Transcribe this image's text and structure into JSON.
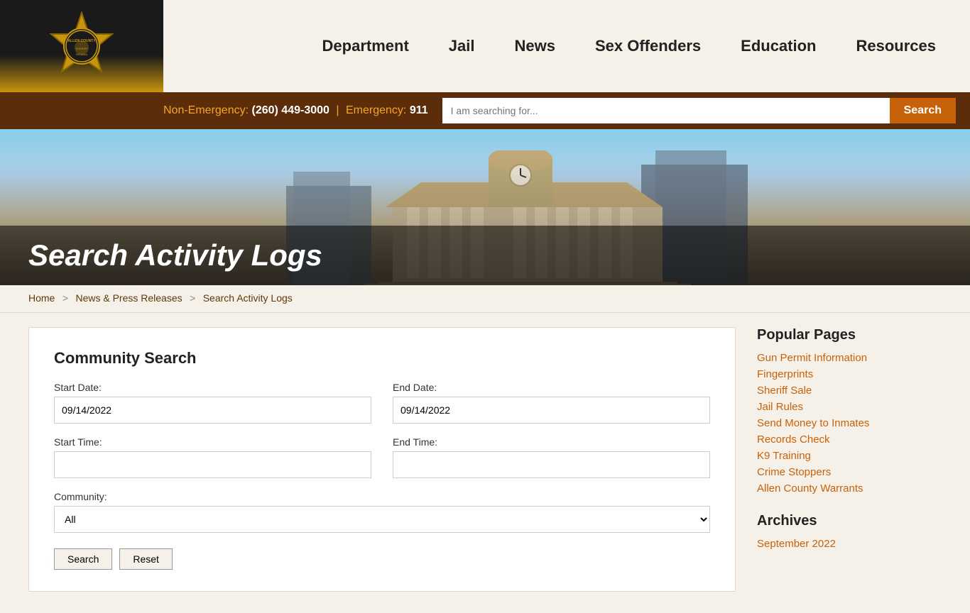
{
  "header": {
    "logo_alt": "Allen County Sheriff Indiana",
    "nav_items": [
      {
        "label": "Department",
        "id": "nav-department"
      },
      {
        "label": "Jail",
        "id": "nav-jail"
      },
      {
        "label": "News",
        "id": "nav-news"
      },
      {
        "label": "Sex Offenders",
        "id": "nav-sex-offenders"
      },
      {
        "label": "Education",
        "id": "nav-education"
      },
      {
        "label": "Resources",
        "id": "nav-resources"
      }
    ]
  },
  "search_bar": {
    "non_emergency_label": "Non-Emergency:",
    "non_emergency_number": "(260) 449-3000",
    "pipe": "|",
    "emergency_label": "Emergency:",
    "emergency_number": "911",
    "search_placeholder": "I am searching for...",
    "search_button_label": "Search"
  },
  "page": {
    "title": "Search Activity Logs"
  },
  "breadcrumb": {
    "home": "Home",
    "section": "News & Press Releases",
    "current": "Search Activity Logs",
    "sep1": ">",
    "sep2": ">"
  },
  "form": {
    "title": "Community Search",
    "start_date_label": "Start Date:",
    "start_date_value": "09/14/2022",
    "end_date_label": "End Date:",
    "end_date_value": "09/14/2022",
    "start_time_label": "Start Time:",
    "start_time_value": "",
    "end_time_label": "End Time:",
    "end_time_value": "",
    "community_label": "Community:",
    "community_value": "All",
    "community_options": [
      "All"
    ],
    "search_button": "Search",
    "reset_button": "Reset"
  },
  "sidebar": {
    "popular_title": "Popular Pages",
    "popular_links": [
      {
        "label": "Gun Permit Information",
        "href": "#"
      },
      {
        "label": "Fingerprints",
        "href": "#"
      },
      {
        "label": "Sheriff Sale",
        "href": "#"
      },
      {
        "label": "Jail Rules",
        "href": "#"
      },
      {
        "label": "Send Money to Inmates",
        "href": "#"
      },
      {
        "label": "Records Check",
        "href": "#"
      },
      {
        "label": "K9 Training",
        "href": "#"
      },
      {
        "label": "Crime Stoppers",
        "href": "#"
      },
      {
        "label": "Allen County Warrants",
        "href": "#"
      }
    ],
    "archives_title": "Archives",
    "archives_links": [
      {
        "label": "September 2022",
        "href": "#"
      }
    ]
  }
}
